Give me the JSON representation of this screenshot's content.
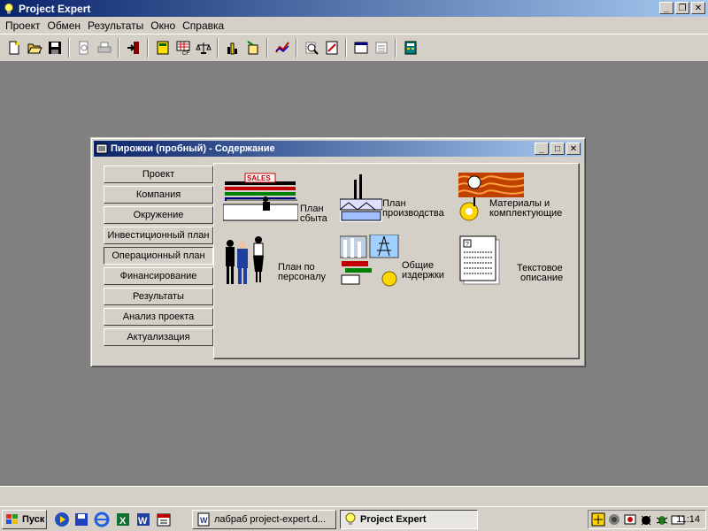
{
  "app": {
    "title": "Project Expert"
  },
  "menu": [
    "Проект",
    "Обмен",
    "Результаты",
    "Окно",
    "Справка"
  ],
  "toolbar": {
    "icons": [
      "new-icon",
      "open-icon",
      "save-icon",
      "preview-icon",
      "print-icon",
      "exit-icon",
      "table-icon",
      "cashflow-icon",
      "balance-icon",
      "chart-bar-icon",
      "export-icon",
      "line-chart-icon",
      "analysis-icon",
      "report-icon",
      "window-icon",
      "list-icon",
      "calculator-icon"
    ]
  },
  "child_window": {
    "title": "Пирожки (пробный) - Содержание",
    "nav": [
      "Проект",
      "Компания",
      "Окружение",
      "Инвестиционный план",
      "Операционный план",
      "Финансирование",
      "Результаты",
      "Анализ проекта",
      "Актуализация"
    ],
    "active_nav": "Операционный план",
    "tiles": {
      "sales_plan": {
        "line1": "План",
        "line2": "сбыта",
        "badge": "SALES"
      },
      "production_plan": {
        "line1": "План",
        "line2": "производства"
      },
      "materials": {
        "line1": "Материалы и",
        "line2": "комплектующие"
      },
      "personnel_plan": {
        "line1": "План по",
        "line2": "персоналу"
      },
      "general_costs": {
        "line1": "Общие",
        "line2": "издержки"
      },
      "text_description": {
        "line1": "Текстовое",
        "line2": "описание"
      }
    }
  },
  "taskbar": {
    "start_label": "Пуск",
    "tasks": [
      "лабраб project-expert.d...",
      "Project Expert"
    ],
    "clock": "11:14"
  }
}
